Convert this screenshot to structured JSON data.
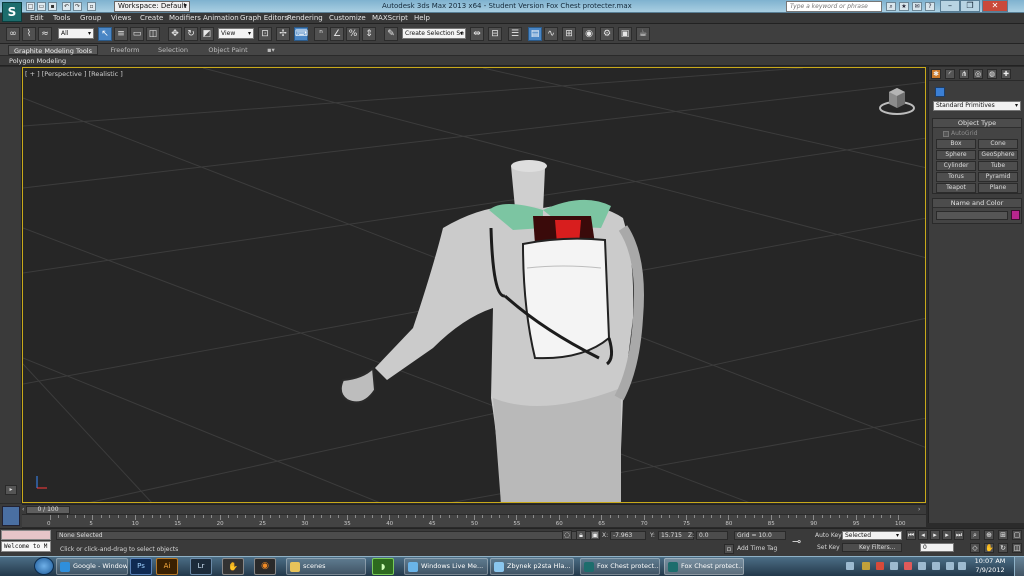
{
  "titlebar": {
    "workspace": "Workspace: Default",
    "title": "Autodesk 3ds Max  2013 x64   - Student Version    Fox Chest protecter.max",
    "search_placeholder": "Type a keyword or phrase",
    "icons": [
      "new-icon",
      "open-icon",
      "save-icon",
      "undo-icon",
      "redo-icon",
      "hold-icon"
    ]
  },
  "menu": [
    "Edit",
    "Tools",
    "Group",
    "Views",
    "Create",
    "Modifiers",
    "Animation",
    "Graph Editors",
    "Rendering",
    "Customize",
    "MAXScript",
    "Help"
  ],
  "toolbar": {
    "selection_filter": "All",
    "reference_coord": "View",
    "named_selection": "Create Selection Se"
  },
  "ribbon": {
    "tabs": [
      "Graphite Modeling Tools",
      "Freeform",
      "Selection",
      "Object Paint"
    ],
    "sub_label": "Polygon Modeling"
  },
  "viewport": {
    "label": "[ + ] [Perspective ] [Realistic ]"
  },
  "command_panel": {
    "category": "Standard Primitives",
    "object_type_title": "Object Type",
    "autogrid_label": "AutoGrid",
    "primitives": [
      "Box",
      "Cone",
      "Sphere",
      "GeoSphere",
      "Cylinder",
      "Tube",
      "Torus",
      "Pyramid",
      "Teapot",
      "Plane"
    ],
    "name_color_title": "Name and Color",
    "accent_color": "#3b7fd4",
    "object_color": "#b8258d"
  },
  "timeline": {
    "slider": "0 / 100",
    "ticks": [
      "0",
      "5",
      "10",
      "15",
      "20",
      "25",
      "30",
      "35",
      "40",
      "45",
      "50",
      "55",
      "60",
      "65",
      "70",
      "75",
      "80",
      "85",
      "90",
      "95",
      "100"
    ]
  },
  "status": {
    "maxscript_listener": "Welcome to M",
    "selection": "None Selected",
    "prompt": "Click or click-and-drag to select objects",
    "x_label": "X:",
    "x_value": "-7.963",
    "y_label": "Y:",
    "y_value": "15.715",
    "z_label": "Z:",
    "z_value": "0.0",
    "grid": "Grid = 10.0",
    "add_time_tag": "Add Time Tag",
    "auto_key": "Auto Key",
    "set_key": "Set Key",
    "key_mode": "Selected",
    "key_filters": "Key Filters...",
    "frame": "0"
  },
  "taskbar": {
    "items": [
      "Google - Window...",
      "scenes",
      "Windows Live Me...",
      "Zbynek p2sta Hla...",
      "Fox Chest protect...",
      "Fox Chest protect..."
    ],
    "time": "10:07 AM",
    "date": "7/9/2012"
  }
}
